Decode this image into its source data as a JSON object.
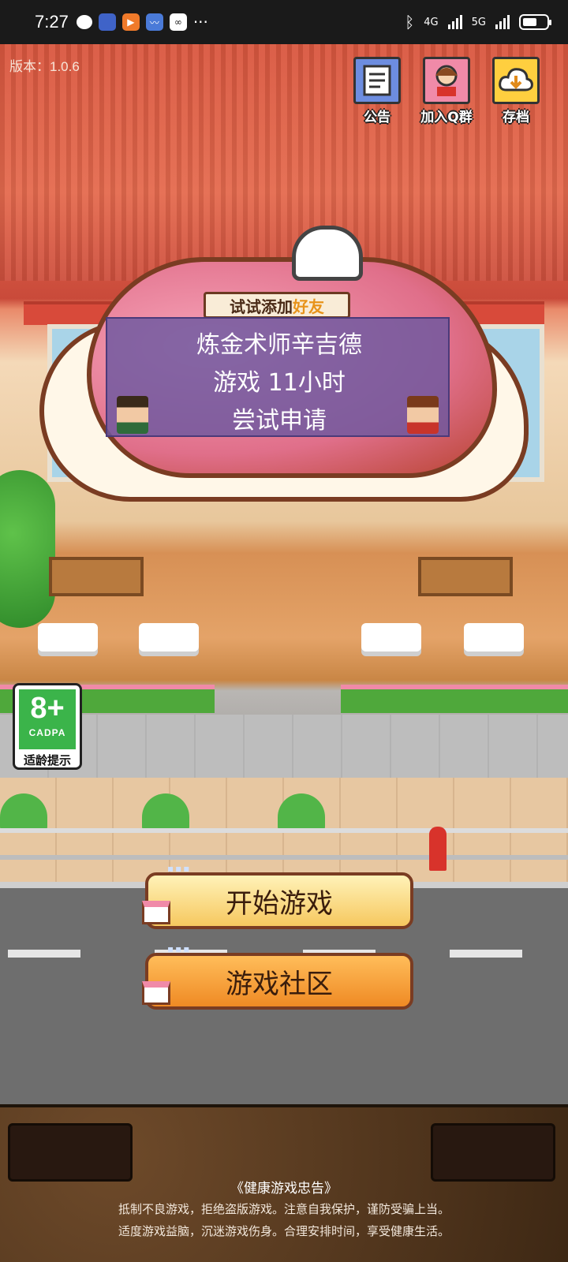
{
  "status_bar": {
    "time": "7:27",
    "signal_a_label": "4G",
    "signal_b_label": "5G",
    "battery_level_percent": 60,
    "icons": [
      "chat-icon",
      "tieba-icon",
      "video-icon",
      "feather-icon",
      "infinity-icon",
      "more-icon",
      "bluetooth-icon"
    ]
  },
  "game": {
    "version": "版本：1.0.6",
    "top_buttons": {
      "announcement": "公告",
      "join_qq_group": "加入Q群",
      "save": "存档"
    },
    "friend_prompt": {
      "prefix": "试试添加",
      "highlight": "好友"
    },
    "popup": {
      "line1": "炼金术师辛吉德",
      "line2": "游戏 11小时",
      "line3": "尝试申请"
    },
    "age_rating": {
      "age": "8+",
      "org": "CADPA",
      "tip": "适龄提示"
    },
    "buttons": {
      "start": "开始游戏",
      "community": "游戏社区"
    },
    "health_notice": {
      "title": "《健康游戏忠告》",
      "line1": "抵制不良游戏，拒绝盗版游戏。注意自我保护，谨防受骗上当。",
      "line2": "适度游戏益脑，沉迷游戏伤身。合理安排时间，享受健康生活。"
    },
    "colors": {
      "popup_bg": "#6c58a0",
      "start_btn": "#f6c85f",
      "community_btn": "#ef8a24",
      "age_green": "#3bb44a"
    }
  }
}
